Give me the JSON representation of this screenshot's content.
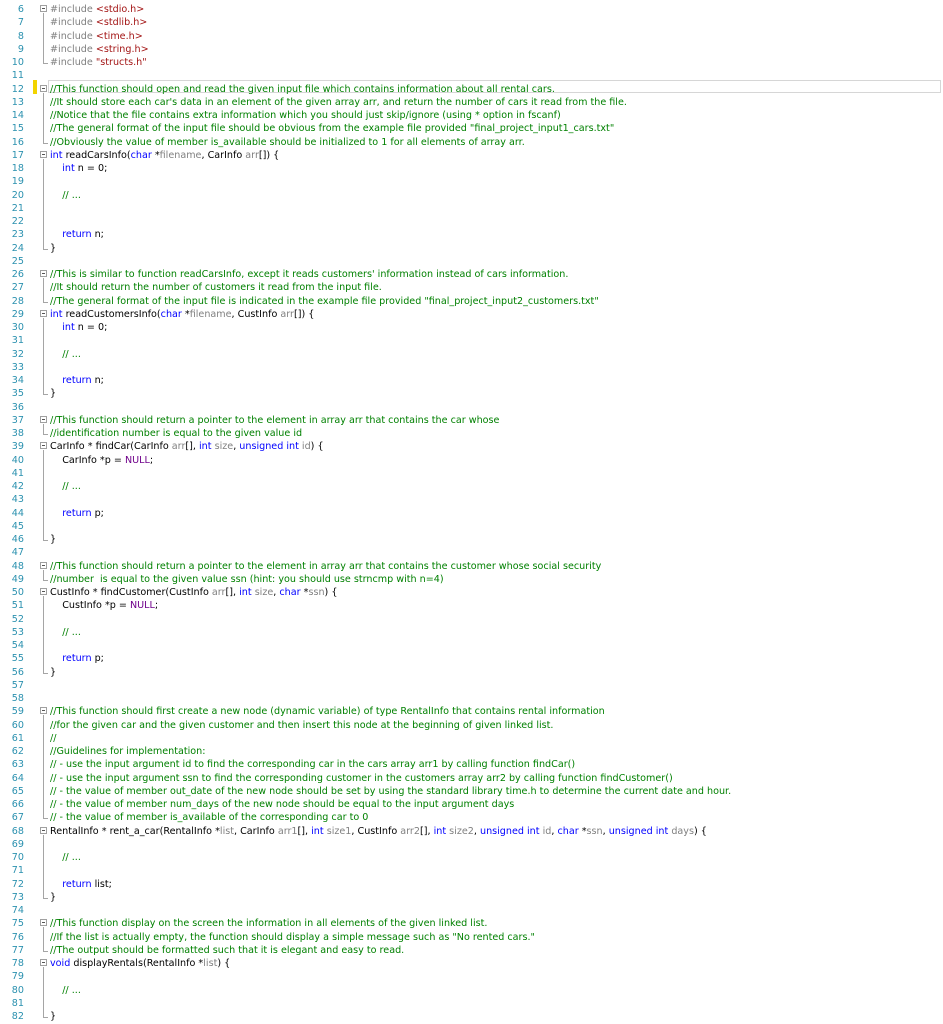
{
  "editor": {
    "lines": [
      {
        "n": "6",
        "fold": "start",
        "segs": [
          {
            "c": "pp",
            "t": "#include "
          },
          {
            "c": "inc",
            "t": "<stdio.h>"
          }
        ]
      },
      {
        "n": "7",
        "segs": [
          {
            "c": "pp",
            "t": "#include "
          },
          {
            "c": "inc",
            "t": "<stdlib.h>"
          }
        ]
      },
      {
        "n": "8",
        "segs": [
          {
            "c": "pp",
            "t": "#include "
          },
          {
            "c": "inc",
            "t": "<time.h>"
          }
        ]
      },
      {
        "n": "9",
        "segs": [
          {
            "c": "pp",
            "t": "#include "
          },
          {
            "c": "inc",
            "t": "<string.h>"
          }
        ]
      },
      {
        "n": "10",
        "fold": "end",
        "segs": [
          {
            "c": "pp",
            "t": "#include "
          },
          {
            "c": "inc",
            "t": "\"structs.h\""
          }
        ]
      },
      {
        "n": "11",
        "segs": []
      },
      {
        "n": "12",
        "fold": "start",
        "segs": [
          {
            "c": "cm",
            "t": "//This function should open and read the given input file which contains information about all rental cars."
          }
        ]
      },
      {
        "n": "13",
        "segs": [
          {
            "c": "cm",
            "t": "//It should store each car's data in an element of the given array arr, and return the number of cars it read from the file."
          }
        ]
      },
      {
        "n": "14",
        "segs": [
          {
            "c": "cm",
            "t": "//Notice that the file contains extra information which you should just skip/ignore (using * option in fscanf)"
          }
        ]
      },
      {
        "n": "15",
        "segs": [
          {
            "c": "cm",
            "t": "//The general format of the input file should be obvious from the example file provided \"final_project_input1_cars.txt\""
          }
        ]
      },
      {
        "n": "16",
        "fold": "end",
        "segs": [
          {
            "c": "cm",
            "t": "//Obviously the value of member is_available should be initialized to 1 for all elements of array arr."
          }
        ]
      },
      {
        "n": "17",
        "fold": "start",
        "segs": [
          {
            "c": "kw",
            "t": "int"
          },
          {
            "c": "tx",
            "t": " readCarsInfo("
          },
          {
            "c": "kw",
            "t": "char"
          },
          {
            "c": "tx",
            "t": " *"
          },
          {
            "c": "pm",
            "t": "filename"
          },
          {
            "c": "tx",
            "t": ", CarInfo "
          },
          {
            "c": "pm",
            "t": "arr"
          },
          {
            "c": "tx",
            "t": "[]) {"
          }
        ]
      },
      {
        "n": "18",
        "segs": [
          {
            "c": "tx",
            "t": "    "
          },
          {
            "c": "kw",
            "t": "int"
          },
          {
            "c": "tx",
            "t": " n = 0;"
          }
        ]
      },
      {
        "n": "19",
        "segs": []
      },
      {
        "n": "20",
        "segs": [
          {
            "c": "tx",
            "t": "    "
          },
          {
            "c": "cm",
            "t": "// ..."
          }
        ]
      },
      {
        "n": "21",
        "segs": []
      },
      {
        "n": "22",
        "segs": []
      },
      {
        "n": "23",
        "segs": [
          {
            "c": "tx",
            "t": "    "
          },
          {
            "c": "kw",
            "t": "return"
          },
          {
            "c": "tx",
            "t": " n;"
          }
        ]
      },
      {
        "n": "24",
        "fold": "end",
        "segs": [
          {
            "c": "tx",
            "t": "}"
          }
        ]
      },
      {
        "n": "25",
        "segs": []
      },
      {
        "n": "26",
        "fold": "start",
        "segs": [
          {
            "c": "cm",
            "t": "//This is similar to function readCarsInfo, except it reads customers' information instead of cars information."
          }
        ]
      },
      {
        "n": "27",
        "segs": [
          {
            "c": "cm",
            "t": "//It should return the number of customers it read from the input file."
          }
        ]
      },
      {
        "n": "28",
        "fold": "end",
        "segs": [
          {
            "c": "cm",
            "t": "//The general format of the input file is indicated in the example file provided \"final_project_input2_customers.txt\""
          }
        ]
      },
      {
        "n": "29",
        "fold": "start",
        "segs": [
          {
            "c": "kw",
            "t": "int"
          },
          {
            "c": "tx",
            "t": " readCustomersInfo("
          },
          {
            "c": "kw",
            "t": "char"
          },
          {
            "c": "tx",
            "t": " *"
          },
          {
            "c": "pm",
            "t": "filename"
          },
          {
            "c": "tx",
            "t": ", CustInfo "
          },
          {
            "c": "pm",
            "t": "arr"
          },
          {
            "c": "tx",
            "t": "[]) {"
          }
        ]
      },
      {
        "n": "30",
        "segs": [
          {
            "c": "tx",
            "t": "    "
          },
          {
            "c": "kw",
            "t": "int"
          },
          {
            "c": "tx",
            "t": " n = 0;"
          }
        ]
      },
      {
        "n": "31",
        "segs": []
      },
      {
        "n": "32",
        "segs": [
          {
            "c": "tx",
            "t": "    "
          },
          {
            "c": "cm",
            "t": "// ..."
          }
        ]
      },
      {
        "n": "33",
        "segs": []
      },
      {
        "n": "34",
        "segs": [
          {
            "c": "tx",
            "t": "    "
          },
          {
            "c": "kw",
            "t": "return"
          },
          {
            "c": "tx",
            "t": " n;"
          }
        ]
      },
      {
        "n": "35",
        "fold": "end",
        "segs": [
          {
            "c": "tx",
            "t": "}"
          }
        ]
      },
      {
        "n": "36",
        "segs": []
      },
      {
        "n": "37",
        "fold": "start",
        "segs": [
          {
            "c": "cm",
            "t": "//This function should return a pointer to the element in array arr that contains the car whose"
          }
        ]
      },
      {
        "n": "38",
        "fold": "end",
        "segs": [
          {
            "c": "cm",
            "t": "//identification number is equal to the given value id"
          }
        ]
      },
      {
        "n": "39",
        "fold": "start",
        "segs": [
          {
            "c": "tx",
            "t": "CarInfo * findCar(CarInfo "
          },
          {
            "c": "pm",
            "t": "arr"
          },
          {
            "c": "tx",
            "t": "[], "
          },
          {
            "c": "kw",
            "t": "int"
          },
          {
            "c": "tx",
            "t": " "
          },
          {
            "c": "pm",
            "t": "size"
          },
          {
            "c": "tx",
            "t": ", "
          },
          {
            "c": "kw",
            "t": "unsigned int"
          },
          {
            "c": "tx",
            "t": " "
          },
          {
            "c": "pm",
            "t": "id"
          },
          {
            "c": "tx",
            "t": ") {"
          }
        ]
      },
      {
        "n": "40",
        "segs": [
          {
            "c": "tx",
            "t": "    CarInfo *p = "
          },
          {
            "c": "mc",
            "t": "NULL"
          },
          {
            "c": "tx",
            "t": ";"
          }
        ]
      },
      {
        "n": "41",
        "segs": []
      },
      {
        "n": "42",
        "segs": [
          {
            "c": "tx",
            "t": "    "
          },
          {
            "c": "cm",
            "t": "// ..."
          }
        ]
      },
      {
        "n": "43",
        "segs": []
      },
      {
        "n": "44",
        "segs": [
          {
            "c": "tx",
            "t": "    "
          },
          {
            "c": "kw",
            "t": "return"
          },
          {
            "c": "tx",
            "t": " p;"
          }
        ]
      },
      {
        "n": "45",
        "segs": []
      },
      {
        "n": "46",
        "fold": "end",
        "segs": [
          {
            "c": "tx",
            "t": "}"
          }
        ]
      },
      {
        "n": "47",
        "segs": []
      },
      {
        "n": "48",
        "fold": "start",
        "segs": [
          {
            "c": "cm",
            "t": "//This function should return a pointer to the element in array arr that contains the customer whose social security"
          }
        ]
      },
      {
        "n": "49",
        "fold": "end",
        "segs": [
          {
            "c": "cm",
            "t": "//number  is equal to the given value ssn (hint: you should use strncmp with n=4)"
          }
        ]
      },
      {
        "n": "50",
        "fold": "start",
        "segs": [
          {
            "c": "tx",
            "t": "CustInfo * findCustomer(CustInfo "
          },
          {
            "c": "pm",
            "t": "arr"
          },
          {
            "c": "tx",
            "t": "[], "
          },
          {
            "c": "kw",
            "t": "int"
          },
          {
            "c": "tx",
            "t": " "
          },
          {
            "c": "pm",
            "t": "size"
          },
          {
            "c": "tx",
            "t": ", "
          },
          {
            "c": "kw",
            "t": "char"
          },
          {
            "c": "tx",
            "t": " *"
          },
          {
            "c": "pm",
            "t": "ssn"
          },
          {
            "c": "tx",
            "t": ") {"
          }
        ]
      },
      {
        "n": "51",
        "segs": [
          {
            "c": "tx",
            "t": "    CustInfo *p = "
          },
          {
            "c": "mc",
            "t": "NULL"
          },
          {
            "c": "tx",
            "t": ";"
          }
        ]
      },
      {
        "n": "52",
        "segs": []
      },
      {
        "n": "53",
        "segs": [
          {
            "c": "tx",
            "t": "    "
          },
          {
            "c": "cm",
            "t": "// ..."
          }
        ]
      },
      {
        "n": "54",
        "segs": []
      },
      {
        "n": "55",
        "segs": [
          {
            "c": "tx",
            "t": "    "
          },
          {
            "c": "kw",
            "t": "return"
          },
          {
            "c": "tx",
            "t": " p;"
          }
        ]
      },
      {
        "n": "56",
        "fold": "end",
        "segs": [
          {
            "c": "tx",
            "t": "}"
          }
        ]
      },
      {
        "n": "57",
        "segs": []
      },
      {
        "n": "58",
        "segs": []
      },
      {
        "n": "59",
        "fold": "start",
        "segs": [
          {
            "c": "cm",
            "t": "//This function should first create a new node (dynamic variable) of type RentalInfo that contains rental information"
          }
        ]
      },
      {
        "n": "60",
        "segs": [
          {
            "c": "cm",
            "t": "//for the given car and the given customer and then insert this node at the beginning of given linked list."
          }
        ]
      },
      {
        "n": "61",
        "segs": [
          {
            "c": "cm",
            "t": "//"
          }
        ]
      },
      {
        "n": "62",
        "segs": [
          {
            "c": "cm",
            "t": "//Guidelines for implementation:"
          }
        ]
      },
      {
        "n": "63",
        "segs": [
          {
            "c": "cm",
            "t": "// - use the input argument id to find the corresponding car in the cars array arr1 by calling function findCar()"
          }
        ]
      },
      {
        "n": "64",
        "segs": [
          {
            "c": "cm",
            "t": "// - use the input argument ssn to find the corresponding customer in the customers array arr2 by calling function findCustomer()"
          }
        ]
      },
      {
        "n": "65",
        "segs": [
          {
            "c": "cm",
            "t": "// - the value of member out_date of the new node should be set by using the standard library time.h to determine the current date and hour."
          }
        ]
      },
      {
        "n": "66",
        "segs": [
          {
            "c": "cm",
            "t": "// - the value of member num_days of the new node should be equal to the input argument days"
          }
        ]
      },
      {
        "n": "67",
        "fold": "end",
        "segs": [
          {
            "c": "cm",
            "t": "// - the value of member is_available of the corresponding car to 0"
          }
        ]
      },
      {
        "n": "68",
        "fold": "start",
        "segs": [
          {
            "c": "tx",
            "t": "RentalInfo * rent_a_car(RentalInfo *"
          },
          {
            "c": "pm",
            "t": "list"
          },
          {
            "c": "tx",
            "t": ", CarInfo "
          },
          {
            "c": "pm",
            "t": "arr1"
          },
          {
            "c": "tx",
            "t": "[], "
          },
          {
            "c": "kw",
            "t": "int"
          },
          {
            "c": "tx",
            "t": " "
          },
          {
            "c": "pm",
            "t": "size1"
          },
          {
            "c": "tx",
            "t": ", CustInfo "
          },
          {
            "c": "pm",
            "t": "arr2"
          },
          {
            "c": "tx",
            "t": "[], "
          },
          {
            "c": "kw",
            "t": "int"
          },
          {
            "c": "tx",
            "t": " "
          },
          {
            "c": "pm",
            "t": "size2"
          },
          {
            "c": "tx",
            "t": ", "
          },
          {
            "c": "kw",
            "t": "unsigned int"
          },
          {
            "c": "tx",
            "t": " "
          },
          {
            "c": "pm",
            "t": "id"
          },
          {
            "c": "tx",
            "t": ", "
          },
          {
            "c": "kw",
            "t": "char"
          },
          {
            "c": "tx",
            "t": " *"
          },
          {
            "c": "pm",
            "t": "ssn"
          },
          {
            "c": "tx",
            "t": ", "
          },
          {
            "c": "kw",
            "t": "unsigned int"
          },
          {
            "c": "tx",
            "t": " "
          },
          {
            "c": "pm",
            "t": "days"
          },
          {
            "c": "tx",
            "t": ") {"
          }
        ]
      },
      {
        "n": "69",
        "segs": []
      },
      {
        "n": "70",
        "segs": [
          {
            "c": "tx",
            "t": "    "
          },
          {
            "c": "cm",
            "t": "// ..."
          }
        ]
      },
      {
        "n": "71",
        "segs": []
      },
      {
        "n": "72",
        "segs": [
          {
            "c": "tx",
            "t": "    "
          },
          {
            "c": "kw",
            "t": "return"
          },
          {
            "c": "tx",
            "t": " list;"
          }
        ]
      },
      {
        "n": "73",
        "fold": "end",
        "segs": [
          {
            "c": "tx",
            "t": "}"
          }
        ]
      },
      {
        "n": "74",
        "segs": []
      },
      {
        "n": "75",
        "fold": "start",
        "segs": [
          {
            "c": "cm",
            "t": "//This function display on the screen the information in all elements of the given linked list."
          }
        ]
      },
      {
        "n": "76",
        "segs": [
          {
            "c": "cm",
            "t": "//If the list is actually empty, the function should display a simple message such as \"No rented cars.\""
          }
        ]
      },
      {
        "n": "77",
        "fold": "end",
        "segs": [
          {
            "c": "cm",
            "t": "//The output should be formatted such that it is elegant and easy to read."
          }
        ]
      },
      {
        "n": "78",
        "fold": "start",
        "segs": [
          {
            "c": "kw",
            "t": "void"
          },
          {
            "c": "tx",
            "t": " displayRentals(RentalInfo *"
          },
          {
            "c": "pm",
            "t": "list"
          },
          {
            "c": "tx",
            "t": ") {"
          }
        ]
      },
      {
        "n": "79",
        "segs": []
      },
      {
        "n": "80",
        "segs": [
          {
            "c": "tx",
            "t": "    "
          },
          {
            "c": "cm",
            "t": "// ..."
          }
        ]
      },
      {
        "n": "81",
        "segs": []
      },
      {
        "n": "82",
        "fold": "end",
        "segs": [
          {
            "c": "tx",
            "t": "}"
          }
        ]
      }
    ]
  }
}
